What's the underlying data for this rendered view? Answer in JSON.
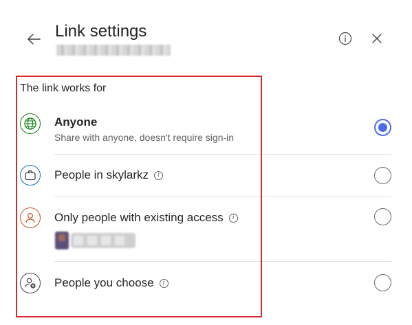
{
  "header": {
    "title": "Link settings",
    "back_icon": "arrow-left-icon",
    "info_icon": "info-icon",
    "close_icon": "close-icon"
  },
  "section": {
    "label": "The link works for"
  },
  "options": [
    {
      "id": "anyone",
      "title": "Anyone",
      "subtitle": "Share with anyone, doesn't require sign-in",
      "icon": "globe-icon",
      "icon_color": "#107c10",
      "selected": true,
      "has_info": false
    },
    {
      "id": "org",
      "title": "People in skylarkz",
      "icon": "briefcase-icon",
      "icon_color": "#0f6cbd",
      "selected": false,
      "has_info": true
    },
    {
      "id": "existing",
      "title": "Only people with existing access",
      "icon": "person-icon",
      "icon_color": "#c4531f",
      "selected": false,
      "has_info": true
    },
    {
      "id": "specific",
      "title": "People you choose",
      "icon": "person-add-icon",
      "icon_color": "#424242",
      "selected": false,
      "has_info": true
    }
  ],
  "colors": {
    "accent": "#4f6bed",
    "highlight": "#d9272e"
  }
}
